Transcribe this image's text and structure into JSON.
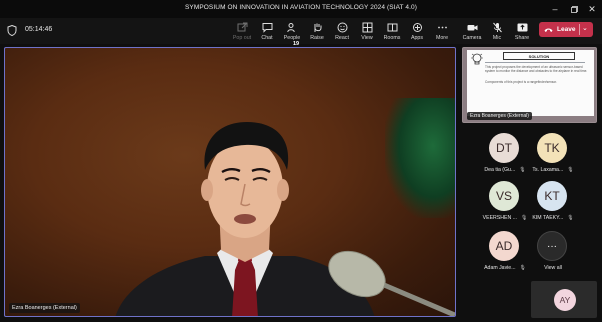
{
  "window": {
    "title": "SYMPOSIUM ON INNOVATION IN AVIATION TECHNOLOGY 2024 (SIAT 4.0)",
    "controls": [
      "minimize",
      "maximize",
      "close"
    ]
  },
  "toolbar": {
    "timer": "05:14:46",
    "buttons": [
      {
        "label": "Pop out",
        "icon": "popout-icon",
        "disabled": true
      },
      {
        "label": "Chat",
        "icon": "chat-icon"
      },
      {
        "label": "People",
        "icon": "people-icon",
        "count": "19"
      },
      {
        "label": "Raise",
        "icon": "hand-icon"
      },
      {
        "label": "React",
        "icon": "smile-icon"
      },
      {
        "label": "View",
        "icon": "view-icon"
      },
      {
        "label": "Rooms",
        "icon": "rooms-icon"
      },
      {
        "label": "Apps",
        "icon": "apps-icon"
      },
      {
        "label": "More",
        "icon": "more-icon"
      },
      {
        "label": "Camera",
        "icon": "camera-icon"
      },
      {
        "label": "Mic",
        "icon": "mic-off-icon"
      },
      {
        "label": "Share",
        "icon": "share-icon"
      }
    ],
    "leave_label": "Leave",
    "leave_color": "#c4314b"
  },
  "main_video": {
    "participant": "Ezra Boanerges (External)"
  },
  "shared_screen": {
    "heading": "SOLUTION",
    "paragraph_1": "This project proposes the development of an ultrasonic sensor-based system to monitor the distance and obstacles to the airplane in real time.",
    "paragraph_2": "Components of this project is a rangefinder/sensor.",
    "presenter": "Ezra Boanerges (External)"
  },
  "participants": [
    {
      "initials": "DT",
      "name": "Dea tia (Gu...",
      "color": "#e8dcd6"
    },
    {
      "initials": "TK",
      "name": "Ts. Laxama...",
      "color": "#f3e2b8"
    },
    {
      "initials": "VS",
      "name": "VEERSHEN ...",
      "color": "#dfe8d6"
    },
    {
      "initials": "KT",
      "name": "KIM TAEKY...",
      "color": "#d7e4f0"
    },
    {
      "initials": "AD",
      "name": "Adam Javie...",
      "color": "#f3d8cf"
    }
  ],
  "view_all_label": "View all",
  "self_view": {
    "initials": "AY"
  }
}
